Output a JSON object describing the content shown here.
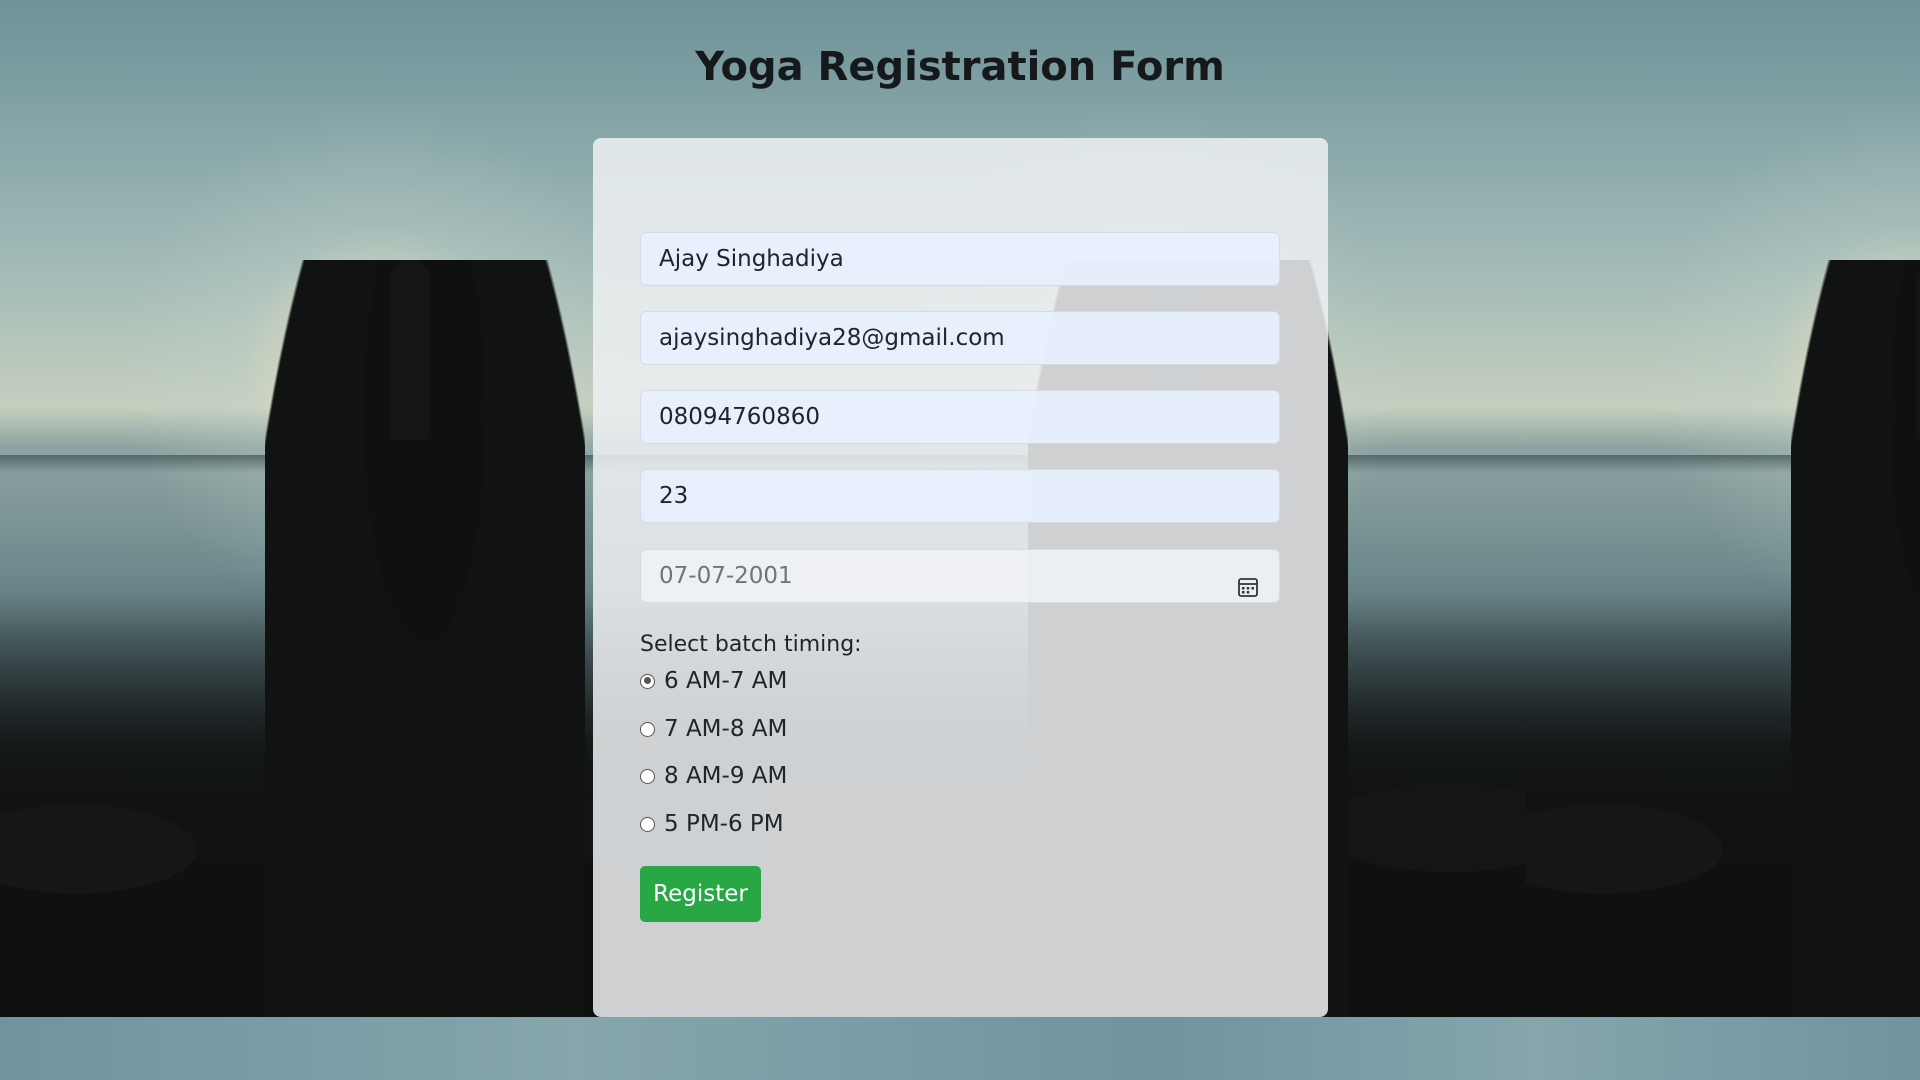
{
  "page": {
    "title": "Yoga Registration Form"
  },
  "form": {
    "name_value": "Ajay Singhadiya",
    "email_value": "ajaysinghadiya28@gmail.com",
    "phone_value": "08094760860",
    "age_value": "23",
    "dob_value": "07-07-2001",
    "batch_label": "Select batch timing:",
    "batches": [
      {
        "label": "6 AM-7 AM",
        "checked": true
      },
      {
        "label": "7 AM-8 AM",
        "checked": false
      },
      {
        "label": "8 AM-9 AM",
        "checked": false
      },
      {
        "label": "5 PM-6 PM",
        "checked": false
      }
    ],
    "submit_label": "Register"
  },
  "icons": {
    "date_picker": "calendar-icon"
  },
  "colors": {
    "accent": "#28a745",
    "card_bg": "#edf0f2",
    "input_bg": "#e8f0fe"
  }
}
